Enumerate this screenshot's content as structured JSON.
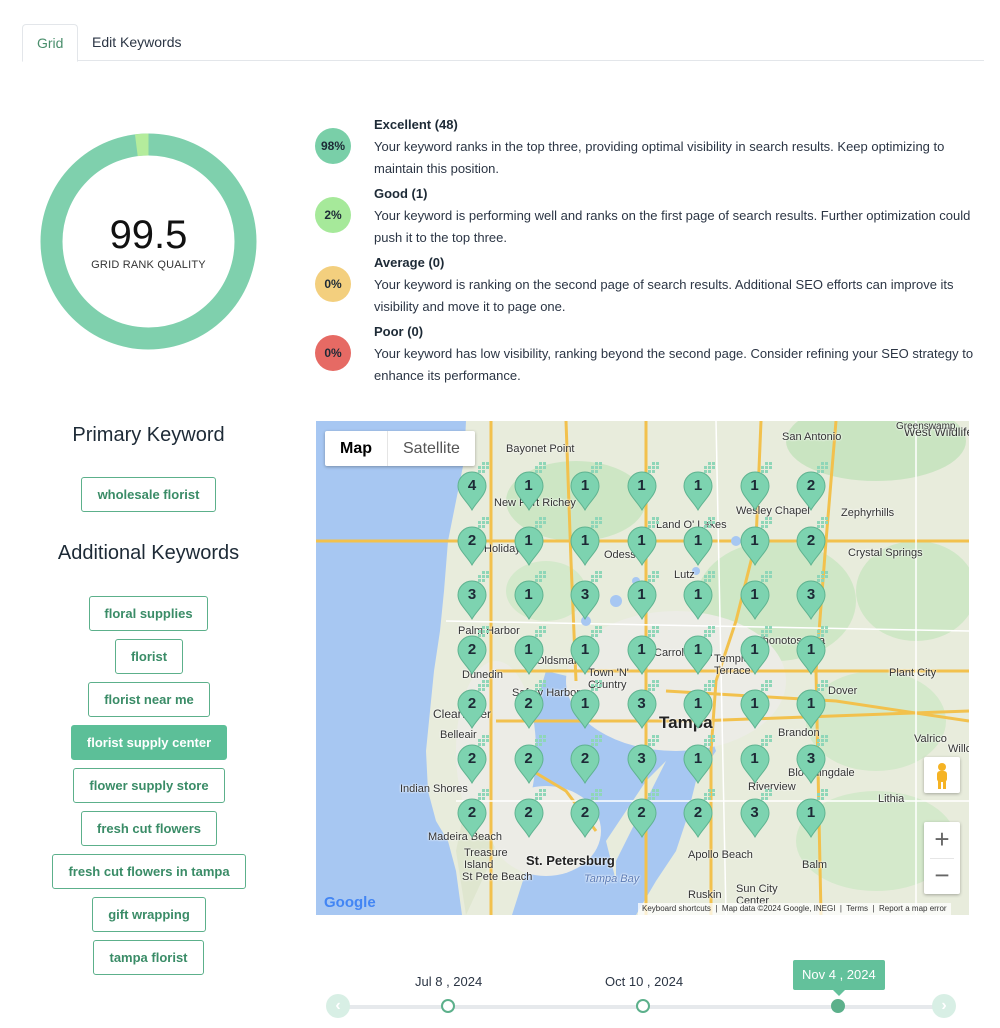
{
  "tabs": [
    {
      "label": "Grid",
      "active": true
    },
    {
      "label": "Edit Keywords",
      "active": false
    }
  ],
  "summary": {
    "score": "99.5",
    "score_label": "GRID RANK QUALITY",
    "donut_fractions": {
      "excellent": 0.98,
      "good": 0.02,
      "average": 0,
      "poor": 0
    }
  },
  "legend": [
    {
      "percent": "98%",
      "title": "Excellent (48)",
      "description": "Your keyword ranks in the top three, providing optimal visibility in search results. Keep optimizing to maintain this position.",
      "color": "#79cfa8"
    },
    {
      "percent": "2%",
      "title": "Good (1)",
      "description": "Your keyword is performing well and ranks on the first page of search results. Further optimization could push it to the top three.",
      "color": "#a6e99a"
    },
    {
      "percent": "0%",
      "title": "Average (0)",
      "description": "Your keyword is ranking on the second page of search results. Additional SEO efforts can improve its visibility and move it to page one.",
      "color": "#f3cf7e"
    },
    {
      "percent": "0%",
      "title": "Poor (0)",
      "description": "Your keyword has low visibility, ranking beyond the second page. Consider refining your SEO strategy to enhance its performance.",
      "color": "#e66a64"
    }
  ],
  "keywords": {
    "primary_heading": "Primary Keyword",
    "primary": "wholesale florist",
    "additional_heading": "Additional Keywords",
    "additional": [
      {
        "label": "floral supplies",
        "active": false
      },
      {
        "label": "florist",
        "active": false
      },
      {
        "label": "florist near me",
        "active": false
      },
      {
        "label": "florist supply center",
        "active": true
      },
      {
        "label": "flower supply store",
        "active": false
      },
      {
        "label": "fresh cut flowers",
        "active": false
      },
      {
        "label": "fresh cut flowers in tampa",
        "active": false
      },
      {
        "label": "gift wrapping",
        "active": false
      },
      {
        "label": "tampa florist",
        "active": false
      }
    ]
  },
  "map": {
    "type_buttons": [
      "Map",
      "Satellite"
    ],
    "active_type": "Map",
    "grid_ranks": [
      [
        "4",
        "1",
        "1",
        "1",
        "1",
        "1",
        "2"
      ],
      [
        "2",
        "1",
        "1",
        "1",
        "1",
        "1",
        "2"
      ],
      [
        "3",
        "1",
        "3",
        "1",
        "1",
        "1",
        "3"
      ],
      [
        "2",
        "1",
        "1",
        "1",
        "1",
        "1",
        "1"
      ],
      [
        "2",
        "2",
        "1",
        "3",
        "1",
        "1",
        "1"
      ],
      [
        "2",
        "2",
        "2",
        "3",
        "1",
        "1",
        "3"
      ],
      [
        "2",
        "2",
        "2",
        "2",
        "2",
        "3",
        "1"
      ]
    ],
    "pin_color": "#7dd3b0",
    "place_labels": [
      "San Antonio",
      "West Wildlife...",
      "Greenswamp",
      "Bayonet Point",
      "New Port Richey",
      "Wesley Chapel",
      "Zephyrhills",
      "Holiday",
      "Odessa",
      "Land O' Lakes",
      "Crystal Springs",
      "Lutz",
      "Palm Harbor",
      "Oldsmar",
      "Town 'N' Country",
      "Carrollwood",
      "Temple Terrace",
      "Plant City",
      "Dunedin",
      "Safety Harbor",
      "Clearwater",
      "Tampa",
      "Dover",
      "Belleair",
      "Brandon",
      "Valrico",
      "Indian Shores",
      "Bloomingdale",
      "Riverview",
      "Lithia",
      "Madeira Beach",
      "Treasure Island",
      "St. Petersburg",
      "St Pete Beach",
      "Apollo Beach",
      "Balm",
      "Ruskin",
      "Sun City Center",
      "Tampa Bay",
      "Keyboard shortcuts",
      "Map data ©2024 Google, INEGI",
      "Terms",
      "Report a map error",
      "Google",
      "Willo...",
      "Thonotosassa"
    ],
    "attribution": [
      "Keyboard shortcuts",
      "Map data ©2024 Google, INEGI",
      "Terms",
      "Report a map error"
    ],
    "logo": "Google",
    "zoom_in": "+",
    "zoom_out": "−"
  },
  "timeline": {
    "dates": [
      {
        "label": "Jul 8 , 2024",
        "selected": false
      },
      {
        "label": "Oct 10 , 2024",
        "selected": false
      },
      {
        "label": "Nov 4 , 2024",
        "selected": true
      }
    ],
    "prev": "‹",
    "next": "›"
  }
}
